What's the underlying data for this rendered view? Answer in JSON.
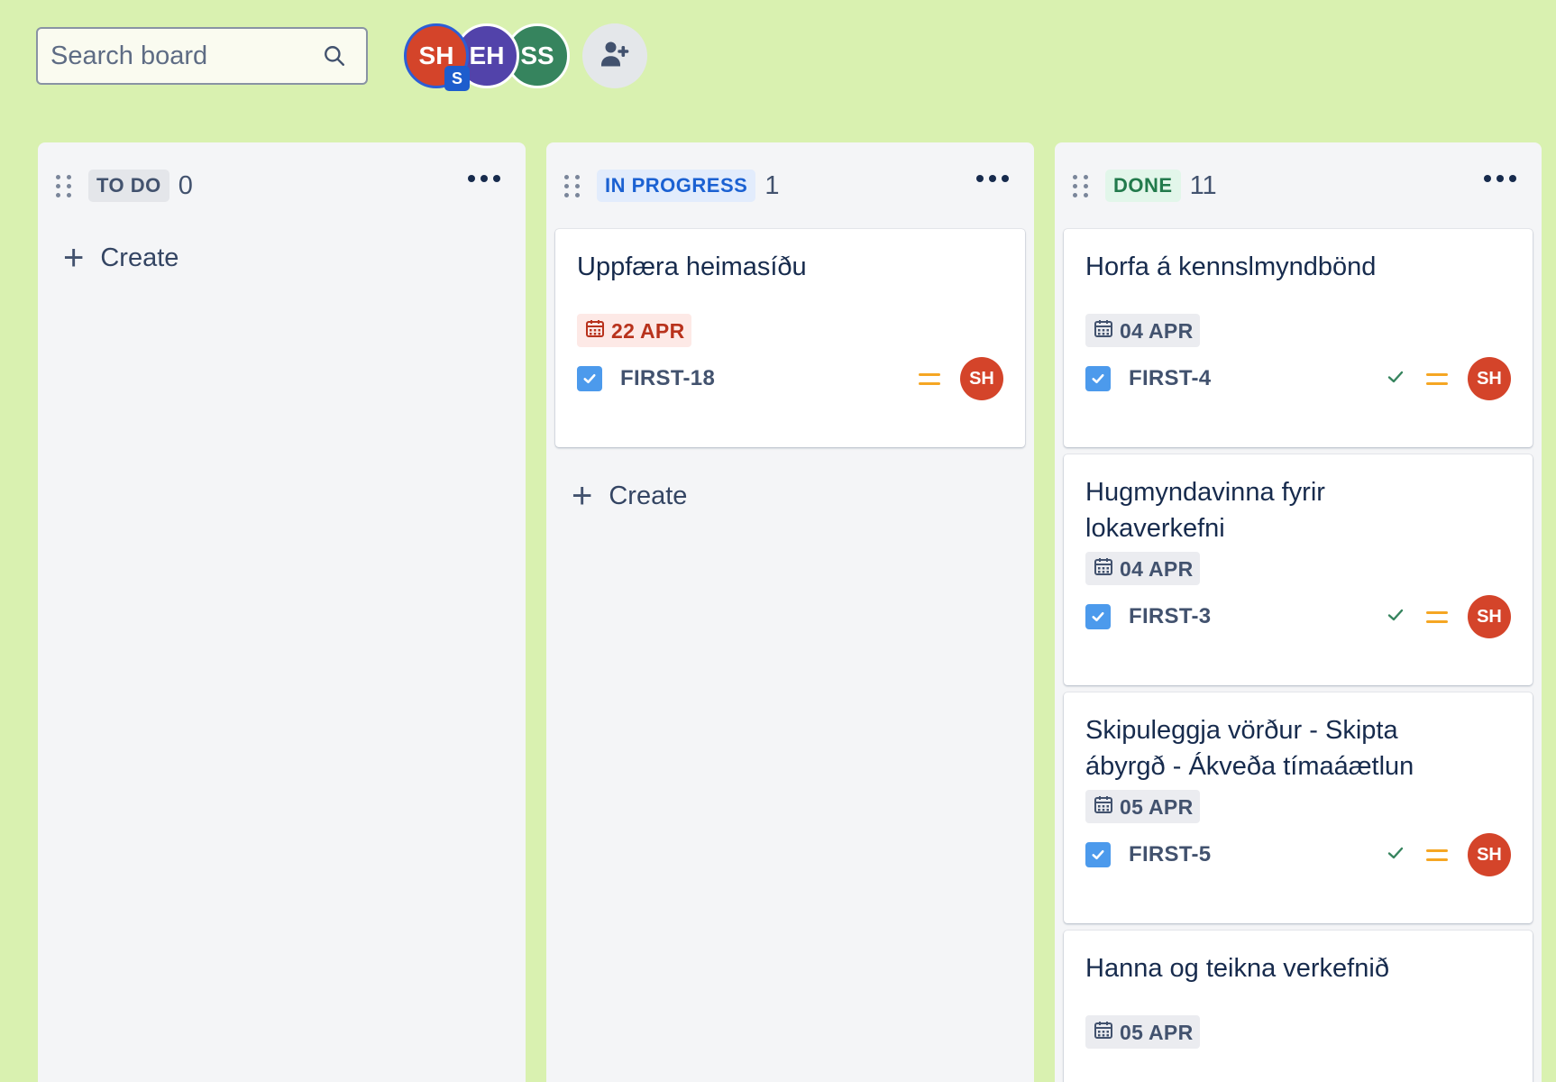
{
  "search": {
    "placeholder": "Search board"
  },
  "avatars": [
    {
      "initials": "SH",
      "badge": "S",
      "color": "#d4442a"
    },
    {
      "initials": "EH",
      "color": "#5243aa"
    },
    {
      "initials": "SS",
      "color": "#36845e"
    }
  ],
  "columns": [
    {
      "status": "TO DO",
      "count": "0",
      "create_label": "Create",
      "cards": []
    },
    {
      "status": "IN PROGRESS",
      "count": "1",
      "create_label": "Create",
      "cards": [
        {
          "title": "Uppfæra heimasíðu",
          "date": "22 APR",
          "date_state": "overdue",
          "key": "FIRST-18",
          "done_check": false,
          "priority": "medium",
          "assignee": "SH"
        }
      ]
    },
    {
      "status": "DONE",
      "count": "11",
      "cards": [
        {
          "title": "Horfa á kennslmyndbönd",
          "date": "04 APR",
          "key": "FIRST-4",
          "done_check": true,
          "priority": "medium",
          "assignee": "SH"
        },
        {
          "title": "Hugmyndavinna fyrir lokaverkefni",
          "date": "04 APR",
          "key": "FIRST-3",
          "done_check": true,
          "priority": "medium",
          "assignee": "SH"
        },
        {
          "title": "Skipuleggja vörður - Skipta ábyrgð - Ákveða tímaáætlun",
          "date": "05 APR",
          "key": "FIRST-5",
          "done_check": true,
          "priority": "medium",
          "assignee": "SH"
        },
        {
          "title": "Hanna og teikna verkefnið",
          "date": "05 APR"
        }
      ]
    }
  ],
  "colors": {
    "background": "#d9f1b0",
    "column": "#f4f5f7",
    "priority": "#f5a623",
    "assignee": "#d4442a",
    "overdue": "#b8321c"
  }
}
